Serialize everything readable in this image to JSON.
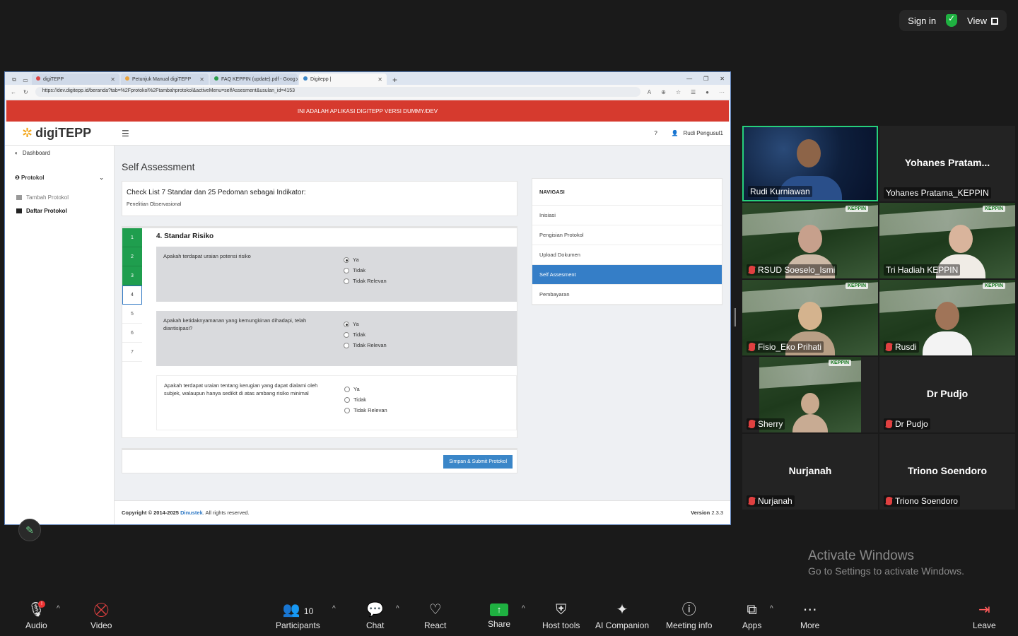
{
  "zoom_top": {
    "sign_in": "Sign in",
    "view": "View"
  },
  "browser": {
    "tabs": [
      {
        "label": "digiTEPP"
      },
      {
        "label": "Petunjuk Manual digiTEPP"
      },
      {
        "label": "FAQ KEPPIN (update).pdf - Goog"
      },
      {
        "label": "Digitepp |"
      }
    ],
    "url": "https://dev.digitepp.id/beranda?tab=%2Fprotokol%2Ftambahprotokol&activeMenu=selfAssesment&usulan_id=4153"
  },
  "app": {
    "banner": "INI ADALAH APLIKASI DIGITEPP VERSI DUMMY/DEV",
    "logo": "digiTEPP",
    "help": "?",
    "user": "Rudi Pengusul1",
    "sidebar": {
      "dashboard": "Dashboard",
      "protokol": "Protokol",
      "tambah": "Tambah Protokol",
      "daftar": "Daftar Protokol"
    },
    "page_title": "Self Assessment",
    "checklist_title": "Check List 7 Standar dan 25 Pedoman sebagai Indikator:",
    "checklist_sub": "Penelitian Observasional",
    "steps": [
      "1",
      "2",
      "3",
      "4",
      "5",
      "6",
      "7"
    ],
    "standard_title": "4. Standar Risiko",
    "questions": [
      {
        "text": "Apakah terdapat uraian potensi risiko",
        "selected": "Ya"
      },
      {
        "text": "Apakah ketidaknyamanan yang kemungkinan dihadapi, telah diantisipasi?",
        "selected": "Ya"
      },
      {
        "text": "Apakah terdapat uraian tentang kerugian yang dapat dialami oleh subjek, walaupun hanya sedikit di atas ambang risiko minimal",
        "selected": ""
      }
    ],
    "options": [
      "Ya",
      "Tidak",
      "Tidak Relevan"
    ],
    "submit": "Simpan & Submit Protokol",
    "nav": {
      "header": "NAVIGASI",
      "items": [
        "Inisiasi",
        "Pengisian Protokol",
        "Upload Dokumen",
        "Self Assesment",
        "Pembayaran"
      ]
    },
    "footer": {
      "copyright": "Copyright © 2014-2025",
      "company": "Dinustek",
      "rights": ". All rights reserved.",
      "version_label": "Version",
      "version": "2.3.3"
    }
  },
  "participants": [
    {
      "name": "Rudi Kurniawan",
      "video": true,
      "muted": false,
      "active": true
    },
    {
      "name": "Yohanes Pratama_KEPPIN",
      "display": "Yohanes  Pratam...",
      "video": false,
      "muted": false
    },
    {
      "name": "RSUD Soeselo_Ismi",
      "video": true,
      "muted": true
    },
    {
      "name": "Tri Hadiah KEPPIN",
      "video": true,
      "muted": false
    },
    {
      "name": "Fisio_Eko Prihati",
      "video": true,
      "muted": true
    },
    {
      "name": "Rusdi",
      "video": true,
      "muted": true
    },
    {
      "name": "Sherry",
      "video": true,
      "muted": true
    },
    {
      "name": "Dr Pudjo",
      "display": "Dr Pudjo",
      "video": false,
      "muted": true
    },
    {
      "name": "Nurjanah",
      "display": "Nurjanah",
      "video": false,
      "muted": true
    },
    {
      "name": "Triono Soendoro",
      "display": "Triono Soendoro",
      "video": false,
      "muted": true
    }
  ],
  "watermark": {
    "line1": "Activate Windows",
    "line2": "Go to Settings to activate Windows."
  },
  "toolbar": {
    "audio": "Audio",
    "video": "Video",
    "participants": "Participants",
    "participants_count": "10",
    "chat": "Chat",
    "react": "React",
    "share": "Share",
    "host_tools": "Host tools",
    "ai": "AI Companion",
    "meeting_info": "Meeting info",
    "apps": "Apps",
    "more": "More",
    "leave": "Leave"
  }
}
